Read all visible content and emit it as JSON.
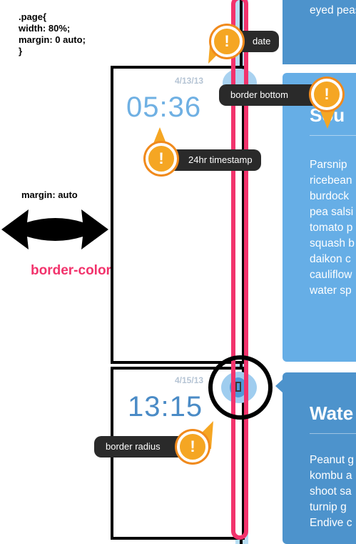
{
  "annotations": {
    "code_note": ".page{\nwidth: 80%;\nmargin: 0 auto;\n}",
    "margin_label": "margin: auto",
    "border_color_label": "border-color: light-blue",
    "callouts": {
      "date": "date",
      "border_bottom": "border bottom",
      "timestamp": "24hr timestamp",
      "border_radius": "border radius"
    }
  },
  "entries": [
    {
      "date": "4/13/13",
      "time": "05:36"
    },
    {
      "date": "4/15/13",
      "time": "13:15"
    }
  ],
  "cards": {
    "top_text": "eyed peas",
    "mid_title": "Sou",
    "mid_lines": [
      "Parsnip",
      "ricebean",
      "burdock",
      "pea salsi",
      "tomato p",
      "squash b",
      "daikon c",
      "cauliflow",
      "water sp"
    ],
    "bot_title": "Wate",
    "bot_lines": [
      "Peanut g",
      "kombu a",
      "shoot sa",
      "turnip g",
      "Endive c"
    ]
  },
  "colors": {
    "pink": "#f2336c",
    "light_blue": "#b8def4",
    "card_blue": "#4d93cc",
    "orange": "#f5a623"
  }
}
